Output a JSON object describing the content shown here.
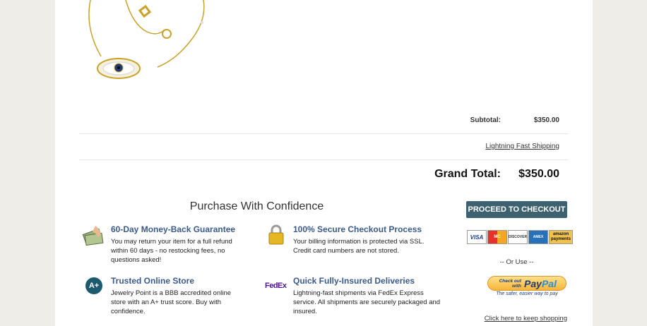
{
  "totals": {
    "subtotal_label": "Subtotal:",
    "subtotal_value": "$350.00",
    "shipping_link": "Lightning Fast Shipping",
    "grand_total_label": "Grand Total:",
    "grand_total_value": "$350.00"
  },
  "confidence": {
    "heading": "Purchase With Confidence",
    "features": [
      {
        "title": "60-Day Money-Back Guarantee",
        "desc": "You may return your item for a full refund within 60 days - no restocking fees, no questions asked!",
        "icon": "money-icon"
      },
      {
        "title": "100% Secure Checkout Process",
        "desc": "Your billing information is protected via SSL. Credit card numbers are not stored.",
        "icon": "lock-icon"
      },
      {
        "title": "Trusted Online Store",
        "desc": "Jewelry Point is a BBB accredited online store with an A+ trust score. Buy with confidence.",
        "icon": "a-plus-icon",
        "badge": "A+"
      },
      {
        "title": "Quick Fully-Insured Deliveries",
        "desc": "Lightning-fast shipments via FedEx Express service. All shipments are securely packaged and insured.",
        "icon": "fedex-icon",
        "badge": "FedEx"
      }
    ]
  },
  "checkout": {
    "proceed_label": "PROCEED TO CHECKOUT",
    "cards": [
      "VISA",
      "MC",
      "DISCOVER",
      "AMEX",
      "amazon payments"
    ],
    "or_use": "-- Or Use --",
    "paypal_small": "Check out with",
    "paypal_pay": "Pay",
    "paypal_pal": "Pal",
    "paypal_tagline": "The safer, easier way to pay",
    "keep_shopping": "Click here to keep shopping"
  },
  "colors": {
    "background": "#eeede7",
    "accent_title": "#3a5a8c",
    "checkout_button": "#3e6170"
  }
}
